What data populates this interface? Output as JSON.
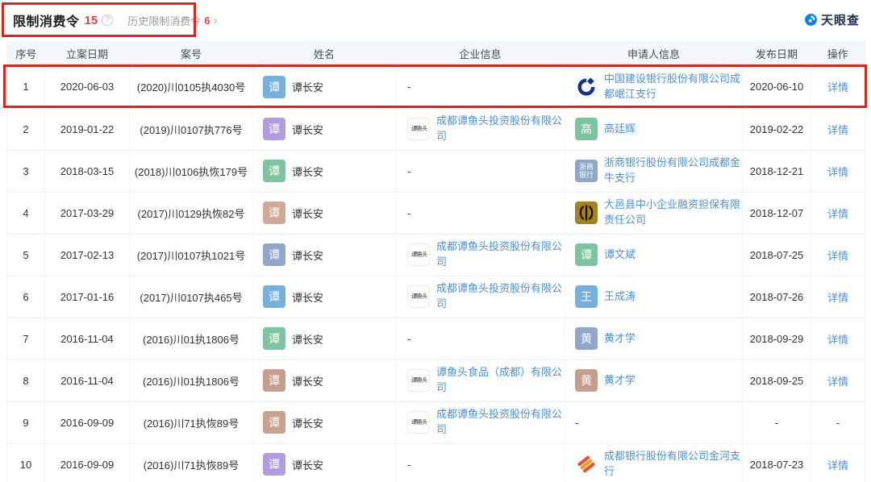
{
  "header": {
    "title": "限制消费令",
    "count": "15",
    "help_icon": "?",
    "history_label": "历史限制消费令",
    "history_count": "6",
    "chevron": "›",
    "brand": "天眼查"
  },
  "colors": {
    "annotation_red": "#e2231a",
    "count_red": "#f53f3f",
    "link_blue": "#4a8fe2",
    "brand_blue": "#0b82f4",
    "header_bg": "#f3f7fb"
  },
  "table": {
    "columns": [
      "序号",
      "立案日期",
      "案号",
      "姓名",
      "企业信息",
      "申请人信息",
      "发布日期",
      "操作"
    ],
    "dash": "-",
    "logo_labels": {
      "tyt": "谭鱼头",
      "zs": "浙商银行"
    },
    "rows": [
      {
        "no": "1",
        "filing_date": "2020-06-03",
        "case_no": "(2020)川0105执4030号",
        "person": {
          "char": "谭",
          "color": "#76b1dc",
          "name": "谭长安"
        },
        "company": null,
        "applicant": {
          "kind": "logo",
          "logo": "ccb",
          "name": "中国建设银行股份有限公司成都岷江支行"
        },
        "publish_date": "2020-06-10",
        "action": "详情",
        "highlight": true
      },
      {
        "no": "2",
        "filing_date": "2019-01-22",
        "case_no": "(2019)川0107执776号",
        "person": {
          "char": "谭",
          "color": "#b49bdf",
          "name": "谭长安"
        },
        "company": {
          "kind": "logo",
          "logo": "tyt",
          "name": "成都谭鱼头投资股份有限公司"
        },
        "applicant": {
          "kind": "avatar",
          "char": "高",
          "color": "#7cc4a0",
          "name": "高廷辉"
        },
        "publish_date": "2019-02-22",
        "action": "详情"
      },
      {
        "no": "3",
        "filing_date": "2018-03-15",
        "case_no": "(2018)川0106执恢179号",
        "person": {
          "char": "谭",
          "color": "#80c3a2",
          "name": "谭长安"
        },
        "company": null,
        "applicant": {
          "kind": "logo",
          "logo": "zs",
          "name": "浙商银行股份有限公司成都金牛支行"
        },
        "publish_date": "2018-12-21",
        "action": "详情"
      },
      {
        "no": "4",
        "filing_date": "2017-03-29",
        "case_no": "(2017)川0129执恢82号",
        "person": {
          "char": "谭",
          "color": "#d2a996",
          "name": "谭长安"
        },
        "company": null,
        "applicant": {
          "kind": "logo",
          "logo": "dayi",
          "name": "大邑县中小企业融资担保有限责任公司"
        },
        "publish_date": "2018-12-07",
        "action": "详情"
      },
      {
        "no": "5",
        "filing_date": "2017-02-13",
        "case_no": "(2017)川0107执1021号",
        "person": {
          "char": "谭",
          "color": "#92a5ca",
          "name": "谭长安"
        },
        "company": {
          "kind": "logo",
          "logo": "tyt",
          "name": "成都谭鱼头投资股份有限公司"
        },
        "applicant": {
          "kind": "avatar",
          "char": "谭",
          "color": "#7cc4a0",
          "name": "谭文斌"
        },
        "publish_date": "2018-07-25",
        "action": "详情"
      },
      {
        "no": "6",
        "filing_date": "2017-01-16",
        "case_no": "(2017)川0107执465号",
        "person": {
          "char": "谭",
          "color": "#76b1dc",
          "name": "谭长安"
        },
        "company": {
          "kind": "logo",
          "logo": "tyt",
          "name": "成都谭鱼头投资股份有限公司"
        },
        "applicant": {
          "kind": "avatar",
          "char": "王",
          "color": "#76b1dc",
          "name": "王成涛"
        },
        "publish_date": "2018-07-26",
        "action": "详情"
      },
      {
        "no": "7",
        "filing_date": "2016-11-04",
        "case_no": "(2016)川01执1806号",
        "person": {
          "char": "谭",
          "color": "#80c3a2",
          "name": "谭长安"
        },
        "company": null,
        "applicant": {
          "kind": "avatar",
          "char": "黄",
          "color": "#92a5ca",
          "name": "黄才学"
        },
        "publish_date": "2018-09-29",
        "action": "详情"
      },
      {
        "no": "8",
        "filing_date": "2016-11-04",
        "case_no": "(2016)川01执1806号",
        "person": {
          "char": "谭",
          "color": "#c79e8d",
          "name": "谭长安"
        },
        "company": {
          "kind": "logo",
          "logo": "tyt",
          "name": "谭鱼头食品（成都）有限公司"
        },
        "applicant": {
          "kind": "avatar",
          "char": "黄",
          "color": "#c79e8d",
          "name": "黄才学"
        },
        "publish_date": "2018-09-25",
        "action": "详情"
      },
      {
        "no": "9",
        "filing_date": "2016-09-09",
        "case_no": "(2016)川71执恢89号",
        "person": {
          "char": "谭",
          "color": "#c9a28f",
          "name": "谭长安"
        },
        "company": {
          "kind": "logo",
          "logo": "tyt",
          "name": "成都谭鱼头投资股份有限公司"
        },
        "applicant": null,
        "publish_date": "-",
        "action": "-"
      },
      {
        "no": "10",
        "filing_date": "2016-09-09",
        "case_no": "(2016)川71执恢89号",
        "person": {
          "char": "谭",
          "color": "#b49bdf",
          "name": "谭长安"
        },
        "company": null,
        "applicant": {
          "kind": "logo",
          "logo": "cdb",
          "name": "成都银行股份有限公司金河支行"
        },
        "publish_date": "2018-07-23",
        "action": "详情"
      }
    ]
  }
}
